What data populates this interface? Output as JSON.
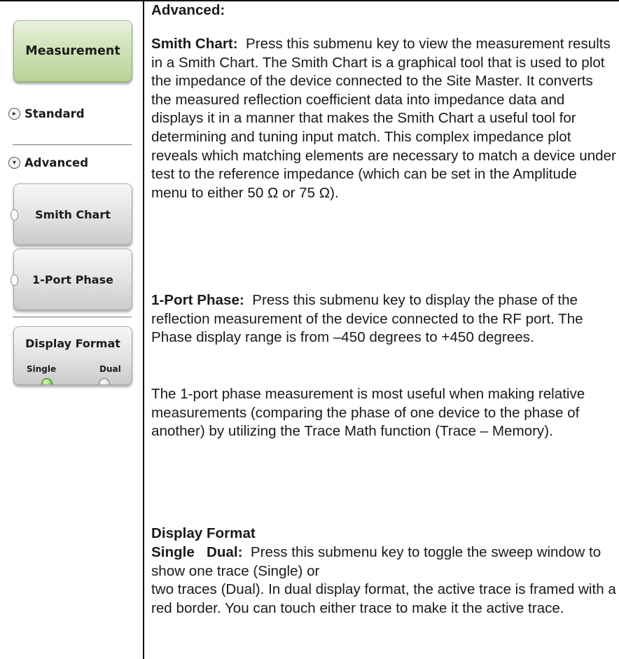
{
  "menu": {
    "title_key": "Measurement",
    "standard_label": "Standard",
    "advanced_label": "Advanced",
    "keys": [
      "Smith Chart",
      "1-Port Phase"
    ],
    "display_format": {
      "label": "Display Format",
      "options": [
        "Single",
        "Dual"
      ],
      "selected": "Single"
    }
  },
  "content": {
    "section_heading": "Advanced:",
    "smith_chart": {
      "term": "Smith Chart:",
      "text": "Press this submenu key to view the measurement results in a Smith Chart. The Smith Chart is a graphical tool that is used to plot the impedance of the device connected to the Site Master. It converts the measured reflection coefficient data into impedance data and displays it in a manner that makes the Smith Chart a useful tool for determining and tuning input match. This complex impedance plot reveals which matching elements are necessary to match a device under test to the reference impedance (which can be set in the Amplitude menu to either 50 Ω or 75 Ω)."
    },
    "one_port_phase": {
      "term": "1-Port Phase:",
      "text": "Press this submenu key to display the phase of the reflection measurement of the device connected to the RF port. The Phase display range is from –450 degrees to +450 degrees."
    },
    "phase_note": "The 1-port phase measurement is most useful when making relative measurements (comparing the phase of one device to the phase of another) by utilizing the Trace Math function (Trace – Memory).",
    "display_format": {
      "heading": "Display Format",
      "term": "Single   Dual:",
      "text": "Press this submenu key to toggle the sweep window to show one trace (Single) or",
      "text2": "two traces (Dual). In dual display format, the active trace is framed with a red border. You can touch either trace to make it the active trace."
    }
  }
}
